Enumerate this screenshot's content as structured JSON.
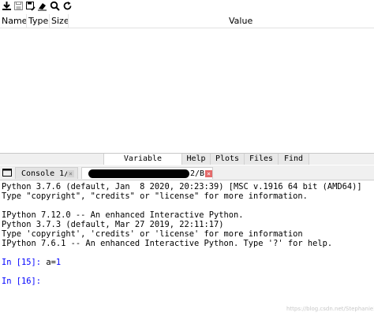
{
  "toolbar": {
    "icons": [
      "download-icon",
      "save-icon",
      "save-as-icon",
      "eraser-icon",
      "search-icon",
      "refresh-icon"
    ]
  },
  "variable_explorer": {
    "columns": [
      "Name",
      "Type",
      "Size",
      "Value"
    ]
  },
  "pane_tabs": [
    "Variable explorer",
    "Help",
    "Plots",
    "Files",
    "Find"
  ],
  "console_tabs": {
    "tab1": "Console 1/A",
    "tab2_suffix": "2/B"
  },
  "console": {
    "lines": [
      "Python 3.7.6 (default, Jan  8 2020, 20:23:39) [MSC v.1916 64 bit (AMD64)]",
      "Type \"copyright\", \"credits\" or \"license\" for more information.",
      "",
      "IPython 7.12.0 -- An enhanced Interactive Python.",
      "Python 3.7.3 (default, Mar 27 2019, 22:11:17)",
      "Type 'copyright', 'credits' or 'license' for more information",
      "IPython 7.6.1 -- An enhanced Interactive Python. Type '?' for help."
    ],
    "in15_prompt": "In [15]:",
    "in15_code_var": "a",
    "in15_code_eq": "=",
    "in15_code_num": "1",
    "in16_prompt": "In [16]:"
  },
  "watermark": "https://blog.csdn.net/Stephanie2014",
  "colors": {
    "prompt": "#0000ff",
    "close_button": "#e46a6a"
  }
}
